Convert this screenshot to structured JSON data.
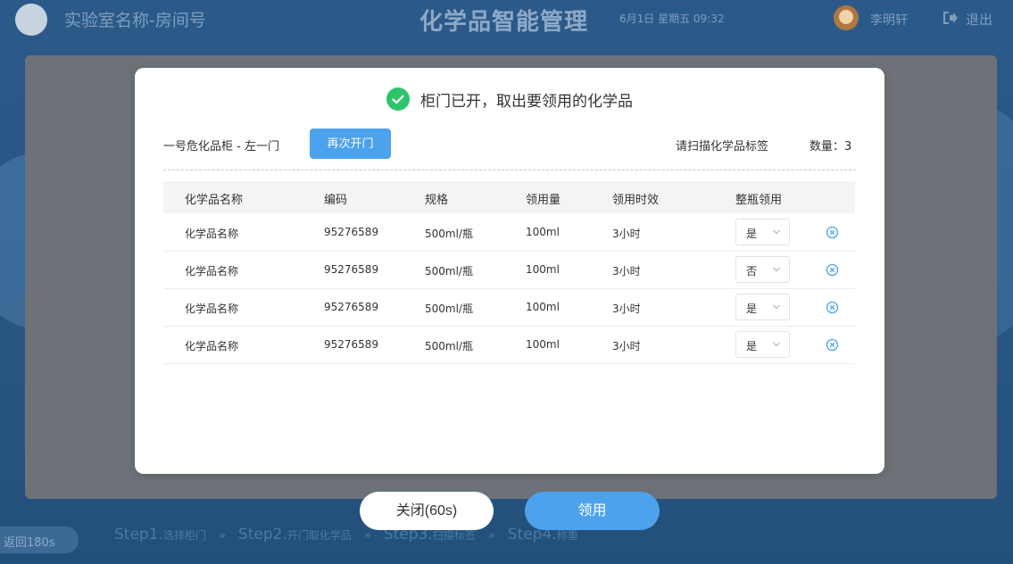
{
  "header": {
    "lab_name": "实验室名称-房间号",
    "app_title": "化学品智能管理",
    "datetime": "6月1日 星期五 09:32",
    "user_name": "李明轩",
    "logout_label": "退出"
  },
  "footer": {
    "return_label": "返回180s",
    "steps": [
      {
        "step": "Step1.",
        "label": "选择柜门"
      },
      {
        "step": "Step2.",
        "label": "开门取化学品"
      },
      {
        "step": "Step3.",
        "label": "扫描标签"
      },
      {
        "step": "Step4.",
        "label": "称重"
      }
    ],
    "separator": "»"
  },
  "modal": {
    "title": "柜门已开，取出要领用的化学品",
    "cabinet": "一号危化品柜 - 左一门",
    "reopen_label": "再次开门",
    "scan_hint": "请扫描化学品标签",
    "quantity": "数量：3",
    "columns": [
      "化学品名称",
      "编码",
      "规格",
      "领用量",
      "领用时效",
      "整瓶领用"
    ],
    "rows": [
      {
        "name": "化学品名称",
        "code": "95276589",
        "spec": "500ml/瓶",
        "amount": "100ml",
        "duration": "3小时",
        "whole": "是"
      },
      {
        "name": "化学品名称",
        "code": "95276589",
        "spec": "500ml/瓶",
        "amount": "100ml",
        "duration": "3小时",
        "whole": "否"
      },
      {
        "name": "化学品名称",
        "code": "95276589",
        "spec": "500ml/瓶",
        "amount": "100ml",
        "duration": "3小时",
        "whole": "是"
      },
      {
        "name": "化学品名称",
        "code": "95276589",
        "spec": "500ml/瓶",
        "amount": "100ml",
        "duration": "3小时",
        "whole": "是"
      }
    ]
  },
  "actions": {
    "close_label": "关闭(60s)",
    "claim_label": "领用"
  },
  "colors": {
    "accent": "#4da2ec",
    "success": "#2fc46c"
  },
  "icons": {
    "check": "check-circle-icon",
    "remove": "close-circle-icon",
    "dropdown": "chevron-down-icon",
    "logout": "logout-icon"
  }
}
